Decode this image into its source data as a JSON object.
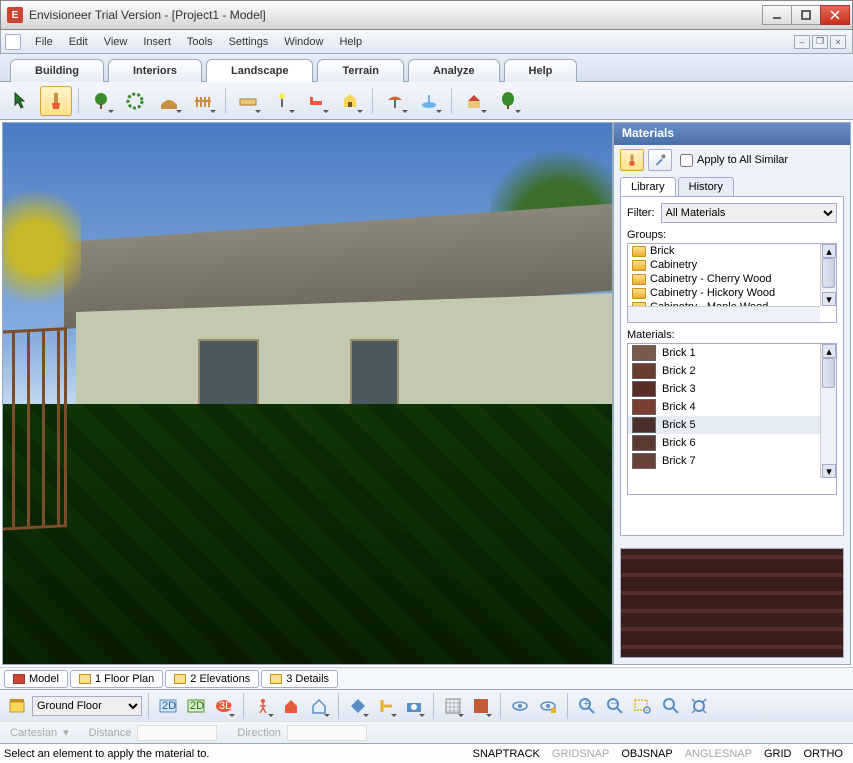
{
  "window": {
    "title": "Envisioneer Trial Version - [Project1 - Model]"
  },
  "menubar": [
    "File",
    "Edit",
    "View",
    "Insert",
    "Tools",
    "Settings",
    "Window",
    "Help"
  ],
  "category_tabs": [
    "Building",
    "Interiors",
    "Landscape",
    "Terrain",
    "Analyze",
    "Help"
  ],
  "active_category": "Landscape",
  "materials_panel": {
    "title": "Materials",
    "apply_all_label": "Apply to All Similar",
    "tabs": [
      "Library",
      "History"
    ],
    "active_tab": "Library",
    "filter_label": "Filter:",
    "filter_value": "All Materials",
    "groups_label": "Groups:",
    "groups": [
      "Brick",
      "Cabinetry",
      "Cabinetry - Cherry Wood",
      "Cabinetry - Hickory Wood",
      "Cabinetry - Maple Wood"
    ],
    "materials_label": "Materials:",
    "materials": [
      {
        "name": "Brick 1",
        "color": "#7a5a4e"
      },
      {
        "name": "Brick 2",
        "color": "#6a3e2e"
      },
      {
        "name": "Brick 3",
        "color": "#5a2e28"
      },
      {
        "name": "Brick 4",
        "color": "#7a3e32"
      },
      {
        "name": "Brick 5",
        "color": "#4a2e2a"
      },
      {
        "name": "Brick 6",
        "color": "#5e3a34"
      },
      {
        "name": "Brick 7",
        "color": "#6a4238"
      }
    ],
    "selected_material": "Brick 5"
  },
  "view_tabs": [
    "Model",
    "1 Floor Plan",
    "2 Elevations",
    "3 Details"
  ],
  "active_view_tab": "Model",
  "floor_selector": "Ground Floor",
  "coords": {
    "mode_label": "Cartesian",
    "distance_label": "Distance",
    "direction_label": "Direction"
  },
  "status": {
    "hint": "Select an element to apply the material to.",
    "toggles": [
      {
        "label": "SNAPTRACK",
        "active": true
      },
      {
        "label": "GRIDSNAP",
        "active": false
      },
      {
        "label": "OBJSNAP",
        "active": true
      },
      {
        "label": "ANGLESNAP",
        "active": false
      },
      {
        "label": "GRID",
        "active": true
      },
      {
        "label": "ORTHO",
        "active": true
      }
    ]
  }
}
